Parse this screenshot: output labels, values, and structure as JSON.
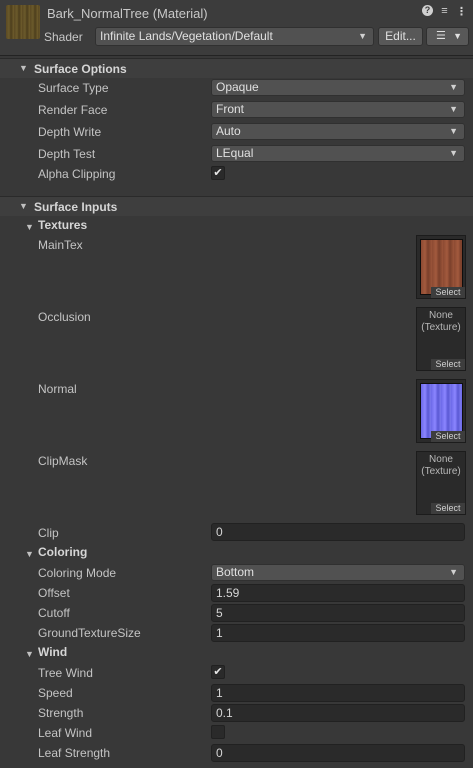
{
  "header": {
    "title": "Bark_NormalTree (Material)",
    "shader_label": "Shader",
    "shader_value": "Infinite Lands/Vegetation/Default",
    "edit_label": "Edit...",
    "help_glyph": "?",
    "settings_glyph": "≡",
    "more_glyph": "⋮",
    "menu_glyph": "☰"
  },
  "surface_options": {
    "title": "Surface Options",
    "surface_type": {
      "label": "Surface Type",
      "value": "Opaque"
    },
    "render_face": {
      "label": "Render Face",
      "value": "Front"
    },
    "depth_write": {
      "label": "Depth Write",
      "value": "Auto"
    },
    "depth_test": {
      "label": "Depth Test",
      "value": "LEqual"
    },
    "alpha_clipping": {
      "label": "Alpha Clipping",
      "checked": true
    }
  },
  "surface_inputs": {
    "title": "Surface Inputs",
    "textures": {
      "title": "Textures",
      "main_tex": {
        "label": "MainTex",
        "select": "Select"
      },
      "occlusion": {
        "label": "Occlusion",
        "none_line1": "None",
        "none_line2": "(Texture)",
        "select": "Select"
      },
      "normal": {
        "label": "Normal",
        "select": "Select"
      },
      "clip_mask": {
        "label": "ClipMask",
        "none_line1": "None",
        "none_line2": "(Texture)",
        "select": "Select"
      }
    },
    "clip": {
      "label": "Clip",
      "value": "0"
    },
    "coloring": {
      "title": "Coloring",
      "coloring_mode": {
        "label": "Coloring Mode",
        "value": "Bottom"
      },
      "offset": {
        "label": "Offset",
        "value": "1.59"
      },
      "cutoff": {
        "label": "Cutoff",
        "value": "5"
      },
      "ground_texture_size": {
        "label": "GroundTextureSize",
        "value": "1"
      }
    },
    "wind": {
      "title": "Wind",
      "tree_wind": {
        "label": "Tree Wind",
        "checked": true
      },
      "speed": {
        "label": "Speed",
        "value": "1"
      },
      "strength": {
        "label": "Strength",
        "value": "0.1"
      },
      "leaf_wind": {
        "label": "Leaf Wind",
        "checked": false
      },
      "leaf_strength": {
        "label": "Leaf Strength",
        "value": "0"
      }
    }
  },
  "glyphs": {
    "triangle": "▼",
    "dropdown": "▼",
    "check": "✔"
  },
  "colors": {
    "background": "#383838",
    "field": "#2a2a2a",
    "dropdown": "#515151"
  }
}
